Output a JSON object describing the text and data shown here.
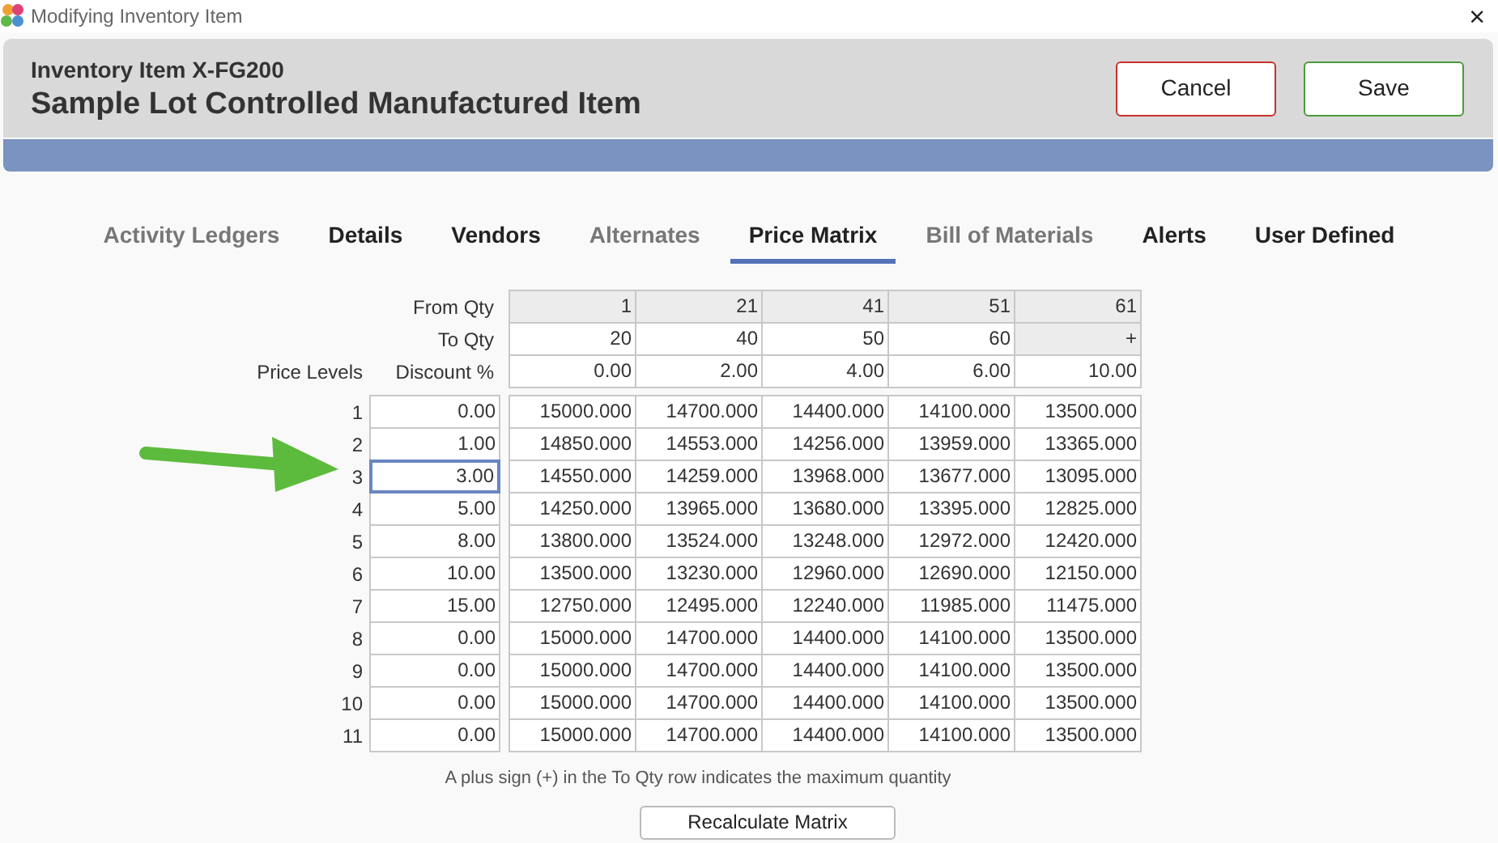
{
  "window": {
    "title": "Modifying Inventory Item",
    "close": "×"
  },
  "header": {
    "subtitle": "Inventory Item X-FG200",
    "title": "Sample Lot Controlled Manufactured Item"
  },
  "buttons": [
    {
      "label": "Cancel",
      "kind": "cancel"
    },
    {
      "label": "Save",
      "kind": "save"
    }
  ],
  "tabs": [
    {
      "label": "Activity Ledgers",
      "selected": false,
      "disabled": true
    },
    {
      "label": "Details",
      "selected": false,
      "disabled": false
    },
    {
      "label": "Vendors",
      "selected": false,
      "disabled": false
    },
    {
      "label": "Alternates",
      "selected": false,
      "disabled": true
    },
    {
      "label": "Price Matrix",
      "selected": true,
      "disabled": false
    },
    {
      "label": "Bill of Materials",
      "selected": false,
      "disabled": true
    },
    {
      "label": "Alerts",
      "selected": false,
      "disabled": false
    },
    {
      "label": "User Defined",
      "selected": false,
      "disabled": false
    }
  ],
  "matrix": {
    "price_levels_label": "Price Levels",
    "header_rows": [
      {
        "label": "From Qty",
        "cells": [
          {
            "text": "1",
            "shaded": true
          },
          {
            "text": "21",
            "shaded": true
          },
          {
            "text": "41",
            "shaded": true
          },
          {
            "text": "51",
            "shaded": true
          },
          {
            "text": "61",
            "shaded": true
          }
        ]
      },
      {
        "label": "To Qty",
        "cells": [
          {
            "text": "20",
            "shaded": false
          },
          {
            "text": "40",
            "shaded": false
          },
          {
            "text": "50",
            "shaded": false
          },
          {
            "text": "60",
            "shaded": false
          },
          {
            "text": "+",
            "shaded": true
          }
        ]
      },
      {
        "label": "Discount %",
        "cells": [
          {
            "text": "0.00",
            "shaded": false
          },
          {
            "text": "2.00",
            "shaded": false
          },
          {
            "text": "4.00",
            "shaded": false
          },
          {
            "text": "6.00",
            "shaded": false
          },
          {
            "text": "10.00",
            "shaded": false
          }
        ]
      }
    ],
    "levels": [
      {
        "number": "1",
        "discount": "0.00",
        "selected": false,
        "prices": [
          "15000.000",
          "14700.000",
          "14400.000",
          "14100.000",
          "13500.000"
        ]
      },
      {
        "number": "2",
        "discount": "1.00",
        "selected": false,
        "prices": [
          "14850.000",
          "14553.000",
          "14256.000",
          "13959.000",
          "13365.000"
        ]
      },
      {
        "number": "3",
        "discount": "3.00",
        "selected": true,
        "prices": [
          "14550.000",
          "14259.000",
          "13968.000",
          "13677.000",
          "13095.000"
        ]
      },
      {
        "number": "4",
        "discount": "5.00",
        "selected": false,
        "prices": [
          "14250.000",
          "13965.000",
          "13680.000",
          "13395.000",
          "12825.000"
        ]
      },
      {
        "number": "5",
        "discount": "8.00",
        "selected": false,
        "prices": [
          "13800.000",
          "13524.000",
          "13248.000",
          "12972.000",
          "12420.000"
        ]
      },
      {
        "number": "6",
        "discount": "10.00",
        "selected": false,
        "prices": [
          "13500.000",
          "13230.000",
          "12960.000",
          "12690.000",
          "12150.000"
        ]
      },
      {
        "number": "7",
        "discount": "15.00",
        "selected": false,
        "prices": [
          "12750.000",
          "12495.000",
          "12240.000",
          "11985.000",
          "11475.000"
        ]
      },
      {
        "number": "8",
        "discount": "0.00",
        "selected": false,
        "prices": [
          "15000.000",
          "14700.000",
          "14400.000",
          "14100.000",
          "13500.000"
        ]
      },
      {
        "number": "9",
        "discount": "0.00",
        "selected": false,
        "prices": [
          "15000.000",
          "14700.000",
          "14400.000",
          "14100.000",
          "13500.000"
        ]
      },
      {
        "number": "10",
        "discount": "0.00",
        "selected": false,
        "prices": [
          "15000.000",
          "14700.000",
          "14400.000",
          "14100.000",
          "13500.000"
        ]
      },
      {
        "number": "11",
        "discount": "0.00",
        "selected": false,
        "prices": [
          "15000.000",
          "14700.000",
          "14400.000",
          "14100.000",
          "13500.000"
        ]
      }
    ],
    "note": "A plus sign (+) in the To Qty row indicates the maximum quantity",
    "recalculate_button": "Recalculate Matrix"
  }
}
